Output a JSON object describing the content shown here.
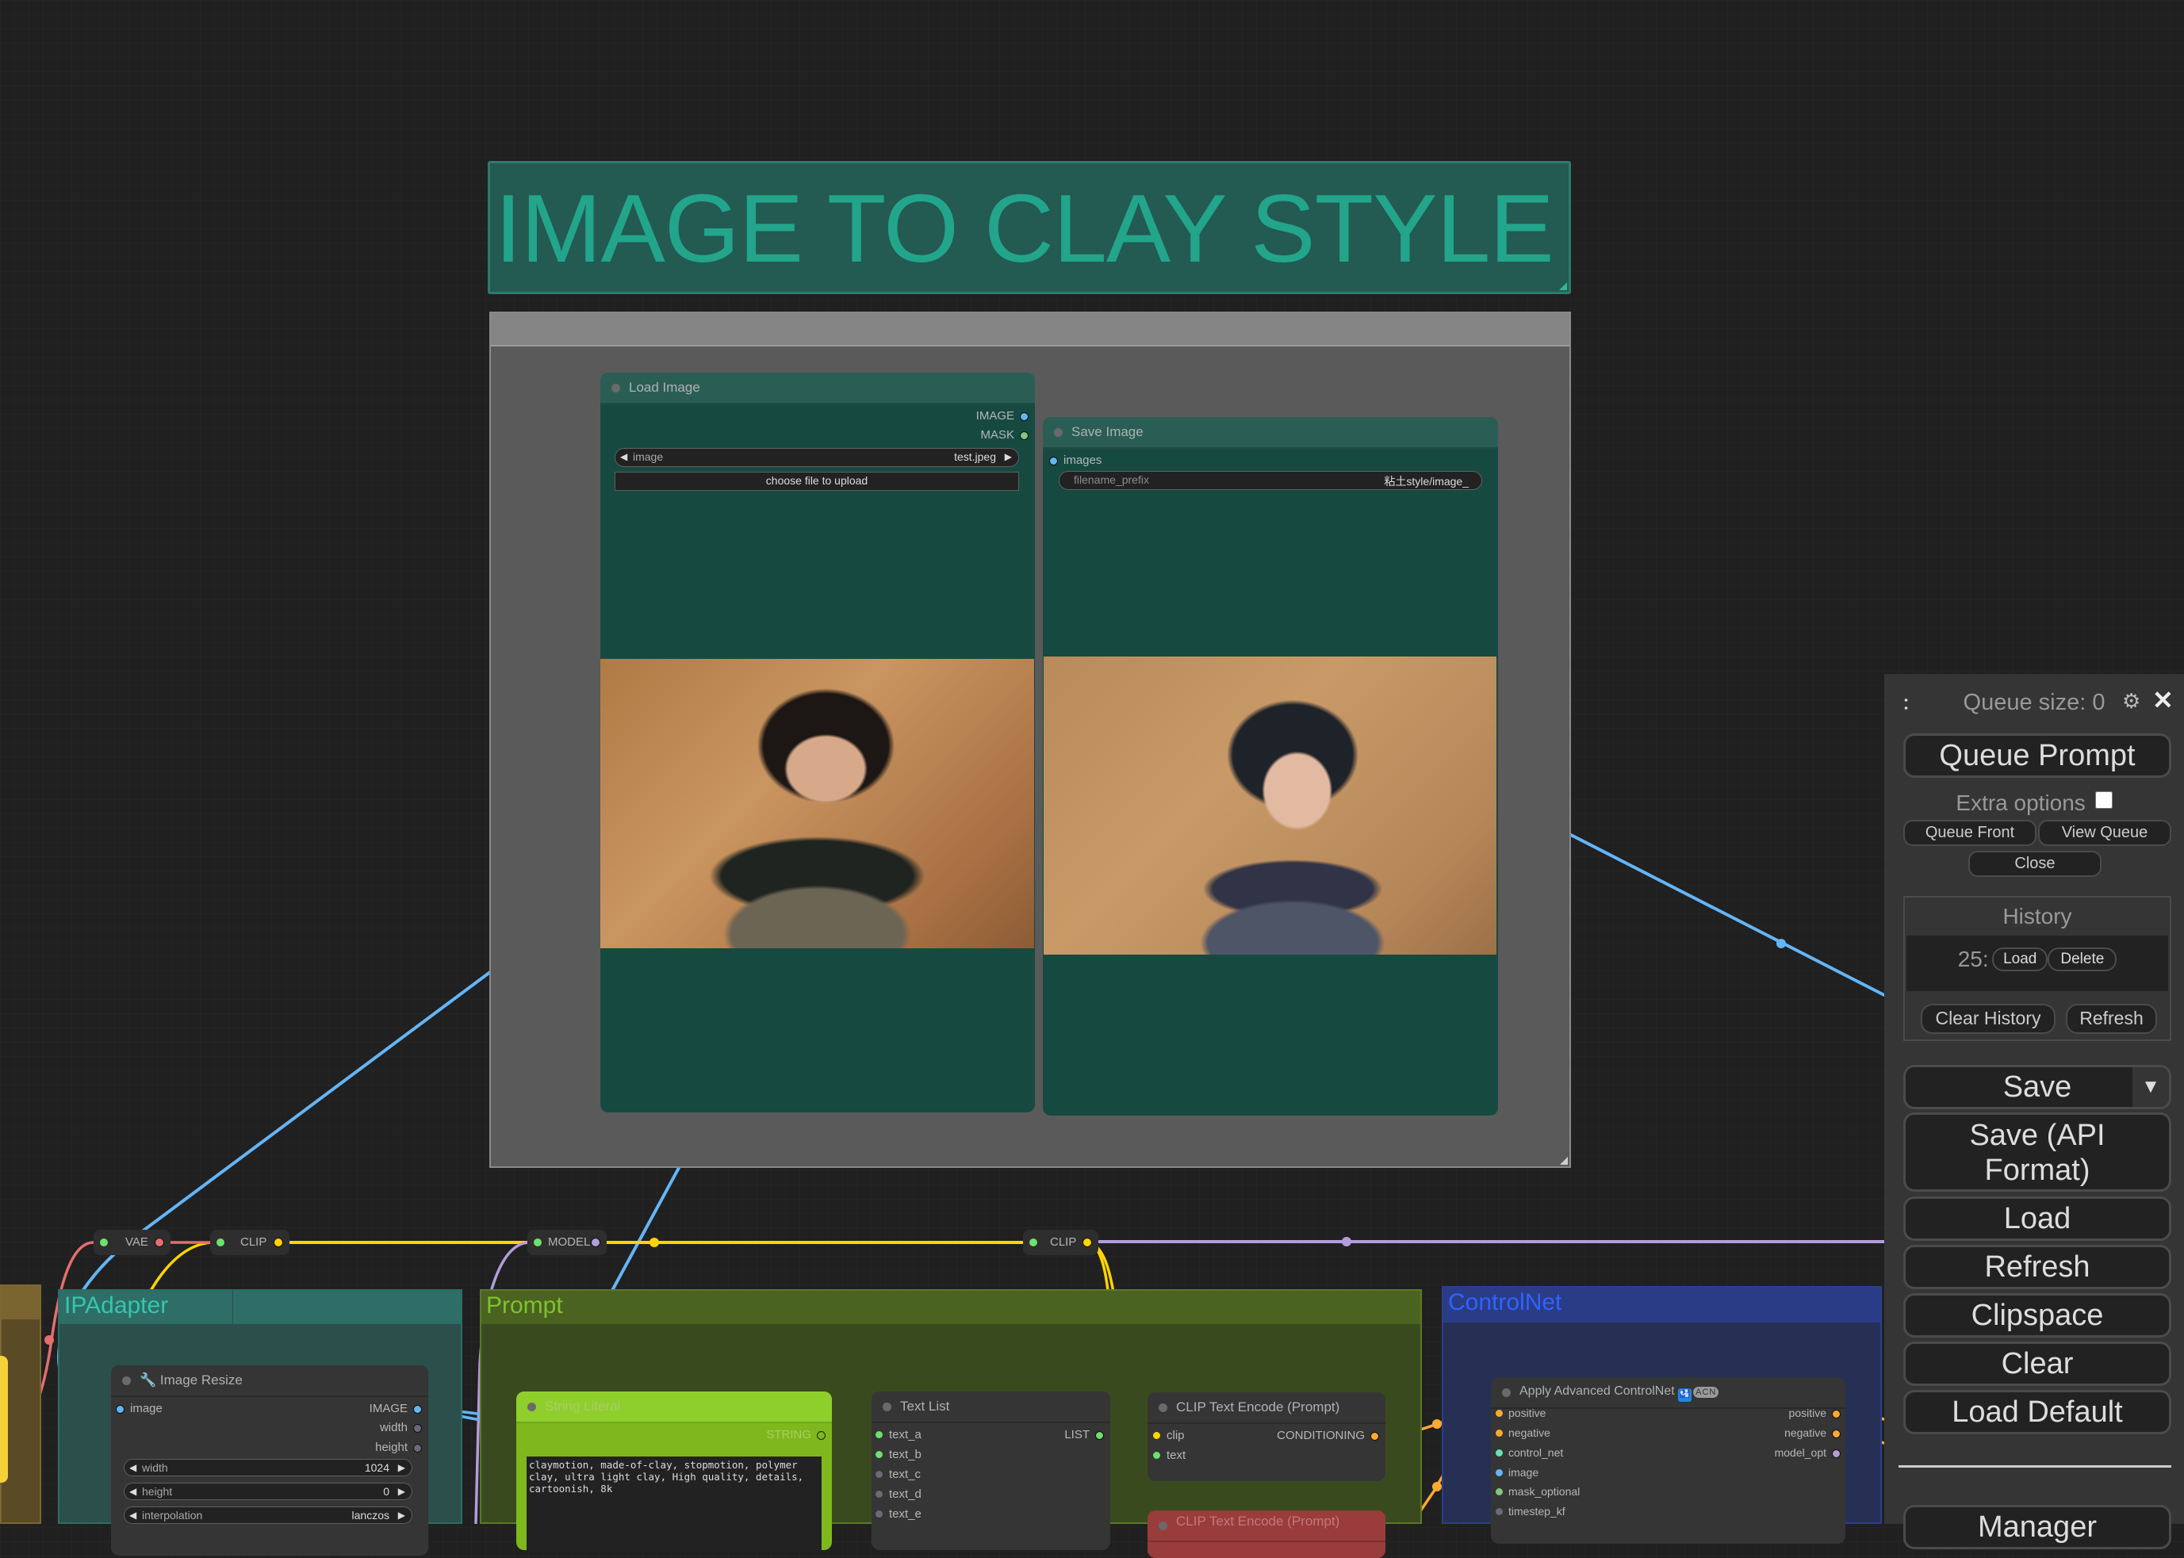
{
  "canvas": {
    "title_note": "IMAGE TO CLAY STYLE",
    "groups": {
      "ipadapter": "IPAdapter",
      "prompt": "Prompt",
      "controlnet": "ControlNet"
    },
    "reroutes": [
      {
        "label": "VAE",
        "color": "#e46e6e"
      },
      {
        "label": "CLIP",
        "color": "#ffd500"
      },
      {
        "label": "MODEL",
        "color": "#b39ddb"
      },
      {
        "label": "CLIP",
        "color": "#ffd500"
      }
    ]
  },
  "nodes": {
    "load_image": {
      "title": "Load Image",
      "outputs": [
        "IMAGE",
        "MASK"
      ],
      "widget_image_label": "image",
      "widget_image_value": "test.jpeg",
      "upload_button": "choose file to upload",
      "preview_alt": "Photo of a young man with curly dark hair in desert clothing and dark scarf"
    },
    "save_image": {
      "title": "Save Image",
      "inputs": [
        "images"
      ],
      "widget_prefix_label": "filename_prefix",
      "widget_prefix_value": "粘土style/image_",
      "preview_alt": "Clay-style rendition of the same character"
    },
    "image_resize": {
      "title": "Image Resize",
      "inputs": [
        "image"
      ],
      "outputs": [
        "IMAGE",
        "width",
        "height"
      ],
      "widgets": [
        {
          "label": "width",
          "value": "1024"
        },
        {
          "label": "height",
          "value": "0"
        },
        {
          "label": "interpolation",
          "value": "lanczos"
        }
      ]
    },
    "string_literal": {
      "title": "String Literal",
      "outputs": [
        "STRING"
      ],
      "text": "claymotion, made-of-clay, stopmotion, polymer clay, ultra light clay, High quality, details, cartoonish, 8k"
    },
    "text_list": {
      "title": "Text List",
      "inputs": [
        "text_a",
        "text_b",
        "text_c",
        "text_d",
        "text_e"
      ],
      "outputs": [
        "LIST"
      ]
    },
    "clip_text_encode": {
      "title": "CLIP Text Encode (Prompt)",
      "inputs": [
        "clip",
        "text"
      ],
      "outputs": [
        "CONDITIONING"
      ]
    },
    "clip_text_encode_negative": {
      "title": "CLIP Text Encode (Prompt)"
    },
    "apply_controlnet": {
      "title": "Apply Advanced ControlNet",
      "badge": "ACN",
      "inputs": [
        "positive",
        "negative",
        "control_net",
        "image",
        "mask_optional",
        "timestep_kf"
      ],
      "outputs": [
        "positive",
        "negative",
        "model_opt"
      ]
    }
  },
  "queue_panel": {
    "queue_size_label": "Queue size: 0",
    "queue_prompt": "Queue Prompt",
    "extra_options": "Extra options",
    "extra_options_checked": false,
    "queue_front": "Queue Front",
    "view_queue": "View Queue",
    "close": "Close",
    "history_title": "History",
    "history_items": [
      {
        "id": "25:",
        "load": "Load",
        "delete": "Delete"
      }
    ],
    "clear_history": "Clear History",
    "refresh_history": "Refresh",
    "save": "Save",
    "save_api": "Save (API Format)",
    "load": "Load",
    "refresh": "Refresh",
    "clipspace": "Clipspace",
    "clear": "Clear",
    "load_default": "Load Default",
    "manager": "Manager"
  },
  "colors": {
    "image_wire": "#64b5f6",
    "clip_wire": "#ffd500",
    "vae_wire": "#e46e6e",
    "model_wire": "#b39ddb",
    "conditioning_wire": "#ffa931",
    "string_wire": "#9fb3a6"
  }
}
